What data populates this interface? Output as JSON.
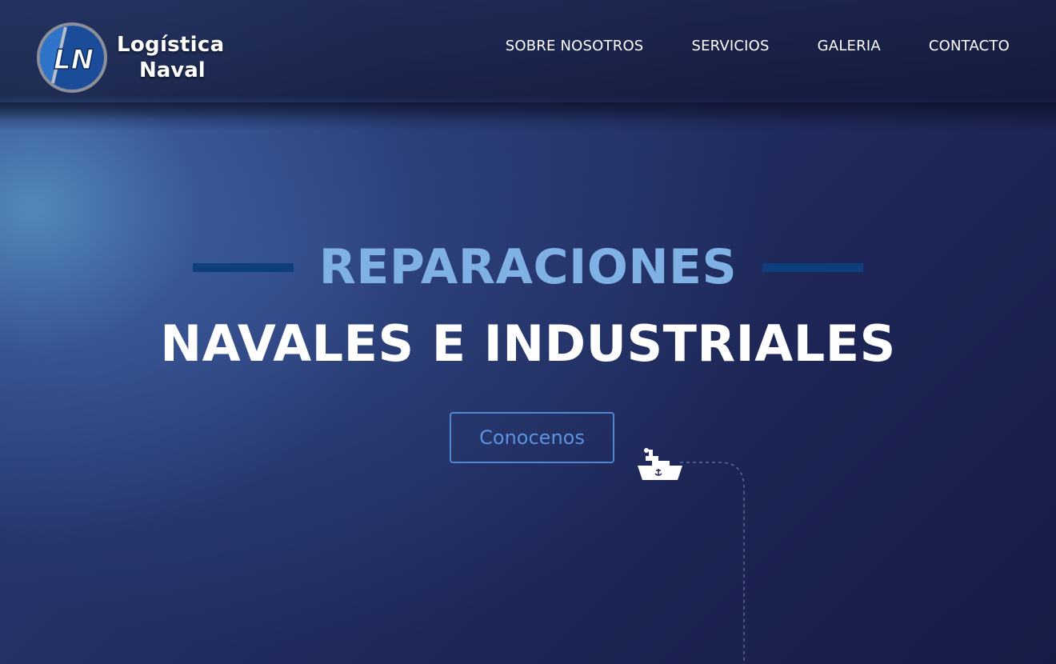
{
  "brand": {
    "name_line1": "Logística",
    "name_line2": "Naval",
    "monogram": "LN"
  },
  "nav": {
    "items": [
      "SOBRE NOSOTROS",
      "SERVICIOS",
      "GALERIA",
      "CONTACTO"
    ]
  },
  "hero": {
    "title_top": "REPARACIONES",
    "title_bottom": "NAVALES E INDUSTRIALES",
    "cta_label": "Conocenos"
  },
  "icons": {
    "ship": "ship-icon",
    "logo": "logo-badge-icon"
  },
  "colors": {
    "accent_light_blue": "#7fb1e4",
    "accent_rule": "#0e3f7c",
    "cta_border": "#4f87d3",
    "background_dark": "#1d2656"
  }
}
